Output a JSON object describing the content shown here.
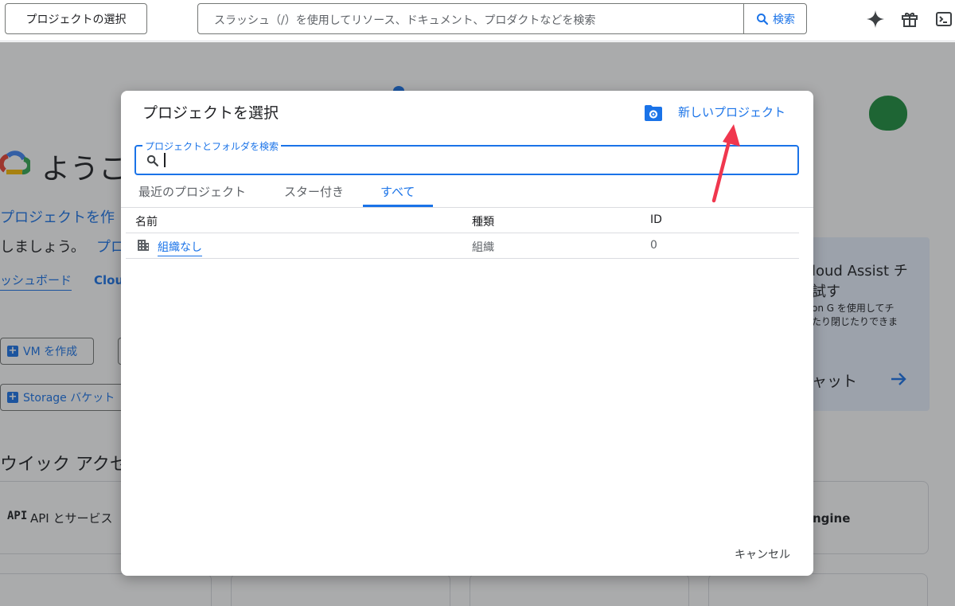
{
  "topbar": {
    "project_picker_label": "プロジェクトの選択",
    "search_placeholder": "スラッシュ（/）を使用してリソース、ドキュメント、プロダクトなどを検索",
    "search_button_label": "検索",
    "icons": [
      "gemini-sparkle-icon",
      "gift-icon",
      "cloud-shell-icon"
    ]
  },
  "background": {
    "welcome_heading": "ようこ",
    "create_project_link": "プロジェクトを作",
    "lets_text": "しましょう。",
    "project_link_fragment": "プロ",
    "dashboard_link": "ッシュボード",
    "cloud_link_fragment": "Clou",
    "create_vm_button": "VM を作成",
    "storage_bucket_button": "Storage バケット",
    "quick_access_heading": "ウイック アクセ",
    "api_services_label": "API とサービス",
    "api_badge": "API",
    "assist_title_line1": "loud Assist チ",
    "assist_title_line2": "試す",
    "assist_body_line1": "on G を使用してチ",
    "assist_body_line2": "たり閉じたりできま",
    "assist_chat_label": "ャット",
    "engine_label": "ngine"
  },
  "dialog": {
    "title": "プロジェクトを選択",
    "new_project_label": "新しいプロジェクト",
    "search_label": "プロジェクトとフォルダを検索",
    "search_value": "",
    "tabs": [
      {
        "label": "最近のプロジェクト",
        "active": false
      },
      {
        "label": "スター付き",
        "active": false
      },
      {
        "label": "すべて",
        "active": true
      }
    ],
    "columns": {
      "name": "名前",
      "type": "種類",
      "id": "ID"
    },
    "rows": [
      {
        "name": "組織なし",
        "type": "組織",
        "id": "0",
        "icon": "organization-icon"
      }
    ],
    "cancel_label": "キャンセル"
  },
  "colors": {
    "accent": "#1a73e8",
    "annotation_arrow": "#f0374e",
    "scrim": "rgba(32,33,36,0.38)"
  }
}
